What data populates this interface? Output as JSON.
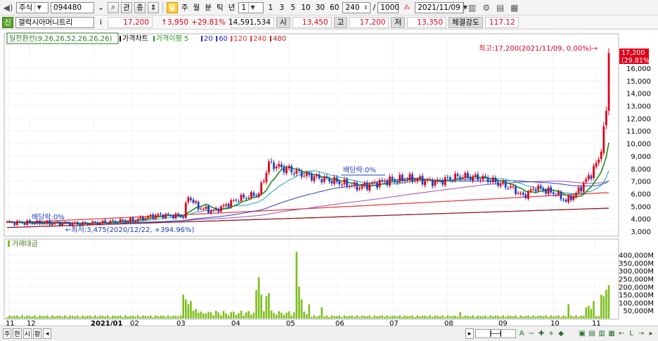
{
  "toolbar": {
    "market": "주식",
    "code": "094480",
    "buttons": [
      "관",
      "종"
    ],
    "period_active": "일",
    "periods": [
      "주",
      "월",
      "분",
      "틱",
      "년"
    ],
    "interval": "1",
    "quick_intervals": [
      "1",
      "3",
      "5",
      "10",
      "30",
      "60"
    ],
    "count": "240",
    "total": "1000",
    "date": "2021/11/09"
  },
  "infobar": {
    "name": "갤럭시아머니트리",
    "price": "17,200",
    "change": "↑3,950",
    "change_pct": "+29.81%",
    "volume": "14,591,534",
    "open_label": "시",
    "open": "13,450",
    "high_label": "고",
    "high": "17,200",
    "low_label": "저",
    "low": "13,350",
    "strength_label": "체결강도",
    "strength": "117.12"
  },
  "chart": {
    "legend_box": "일전환선(9,26,26,52,26,26,26)",
    "legend_items": [
      {
        "text": "가격차트",
        "color": "#000000"
      },
      {
        "text": "가격이평 5",
        "color": "#1f9a1f"
      },
      {
        "text": "20",
        "color": "#1f1fcc"
      },
      {
        "text": "60",
        "color": "#1f1fcc"
      },
      {
        "text": "120",
        "color": "#e03030"
      },
      {
        "text": "240",
        "color": "#e03030"
      },
      {
        "text": "480",
        "color": "#b02020"
      }
    ],
    "high_note": "최고:17,200(2021/11/09, 0.00%)→",
    "low_note": "←최저:3,475(2020/12/22, +394.96%)",
    "dividend_1": "배당락:0%",
    "dividend_2": "배당락:0%",
    "last_price": "17,200",
    "last_pct": "(29.81%)",
    "price_axis": [
      "16,000",
      "15,000",
      "14,000",
      "13,000",
      "12,000",
      "11,000",
      "10,000",
      "9,000",
      "8,000",
      "7,000",
      "6,000",
      "5,000",
      "4,000",
      "3,000"
    ],
    "volume_legend": "거래대금",
    "volume_axis": [
      "400,000M",
      "350,000M",
      "300,000M",
      "250,000M",
      "200,000M",
      "150,000M",
      "100,000M",
      "50,000M"
    ],
    "x_axis": [
      "11",
      "12",
      "2021/01",
      "02",
      "03",
      "04",
      "05",
      "06",
      "07",
      "08",
      "09",
      "10",
      "11"
    ],
    "colors": {
      "up": "#e0001b",
      "down": "#1f3fbf",
      "ma5": "#1f9a1f",
      "ma20": "#1f3fbf",
      "volume": "#7fbf1f",
      "grid": "#dcdcdc"
    }
  },
  "bottombar": {
    "tabs": [
      "주",
      "현",
      "시",
      "황"
    ]
  }
}
